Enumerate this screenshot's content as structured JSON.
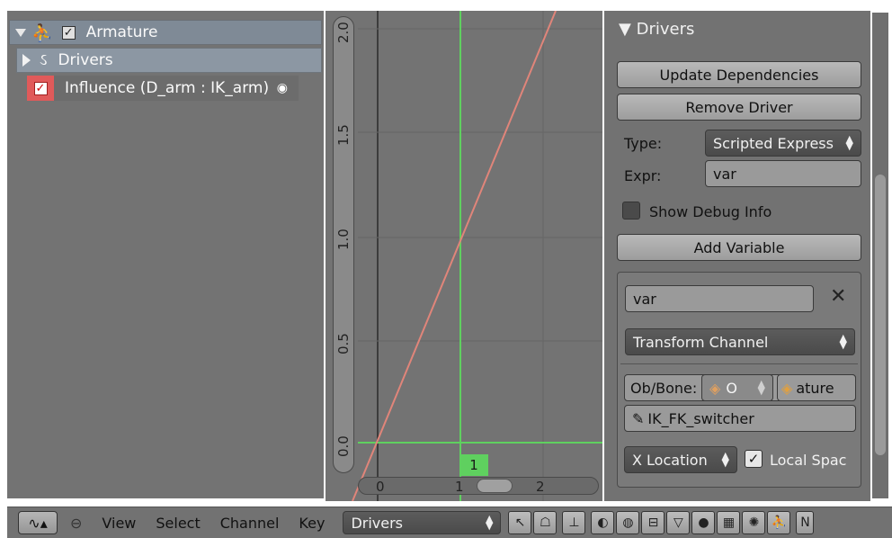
{
  "channels": {
    "armature_label": "Armature",
    "drivers_label": "Drivers",
    "influence_label": "Influence (D_arm : IK_arm)"
  },
  "graph": {
    "y_ticks": [
      "2.0",
      "1.5",
      "1.0",
      "0.5",
      "0.0"
    ],
    "x_ticks": [
      "0",
      "1",
      "2"
    ],
    "current_frame": "1"
  },
  "drivers_panel": {
    "title": "Drivers",
    "update_dependencies": "Update Dependencies",
    "remove_driver": "Remove Driver",
    "type_label": "Type:",
    "type_value": "Scripted Express",
    "expr_label": "Expr:",
    "expr_value": "var",
    "show_debug_info": "Show Debug Info",
    "show_debug_checked": false,
    "add_variable": "Add Variable",
    "variable": {
      "name": "var",
      "type": "Transform Channel",
      "ob_bone_label": "Ob/Bone:",
      "object_field": "O",
      "armature_field": "ature",
      "bone_field": "IK_FK_switcher",
      "channel": "X Location",
      "local_space_label": "Local Spac",
      "local_space_checked": true
    }
  },
  "header": {
    "menus": [
      "View",
      "Select",
      "Channel",
      "Key"
    ],
    "mode_value": "Drivers",
    "truncated_right": "N"
  },
  "colors": {
    "curve": "#e0857a",
    "frame_line": "#5fd05f"
  }
}
